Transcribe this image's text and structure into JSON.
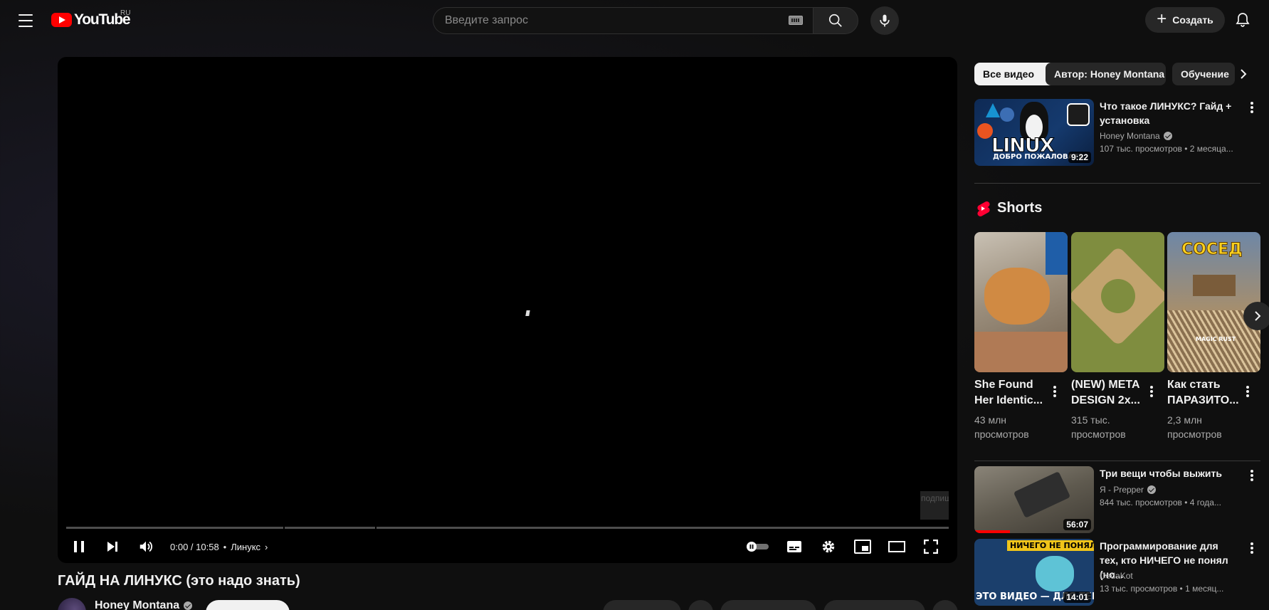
{
  "header": {
    "logo_text": "YouTube",
    "logo_country": "RU",
    "search_placeholder": "Введите запрос",
    "create_label": "Создать"
  },
  "player": {
    "time": "0:00 / 10:58",
    "chapter": "Линукс",
    "watermark_text": "подпишись!"
  },
  "video": {
    "title": "ГАЙД НА ЛИНУКС (это надо знать)",
    "channel": "Honey Montana"
  },
  "sidebar": {
    "chips": [
      "Все видео",
      "Автор: Honey Montana",
      "Обучение"
    ],
    "videos": [
      {
        "title": "Что такое ЛИНУКС? Гайд + установка",
        "channel": "Honey Montana",
        "meta": "107 тыс. просмотров • 2 месяца...",
        "duration": "9:22",
        "thumb_text": "LINUX",
        "thumb_subtext": "ДОБРО ПОЖАЛОВАТЬ"
      },
      {
        "title": "Три вещи чтобы выжить",
        "channel": "Я - Prepper",
        "meta": "844 тыс. просмотров • 4 года...",
        "duration": "56:07"
      },
      {
        "title": "Программирование для тех, кто НИЧЕГО не понял (но...",
        "channel": "DedaKot",
        "meta": "13 тыс. просмотров • 1 месяц...",
        "duration": "14:01",
        "thumb_text": "НИЧЕГО НЕ ПОНЯЛ?",
        "thumb_subtext": "ЭТО ВИДЕО — ДЛЯ ТЕБЯ"
      }
    ],
    "shorts_heading": "Shorts",
    "shorts": [
      {
        "title": "She Found Her Identic...",
        "views": "43 млн просмотров"
      },
      {
        "title": "(NEW) META DESIGN 2x...",
        "views": "315 тыс. просмотров"
      },
      {
        "title": "Как стать ПАРАЗИТО...",
        "views": "2,3 млн просмотров",
        "thumb_text": "СОСЕД",
        "thumb_subtext": "MAGIC RUST"
      }
    ]
  }
}
